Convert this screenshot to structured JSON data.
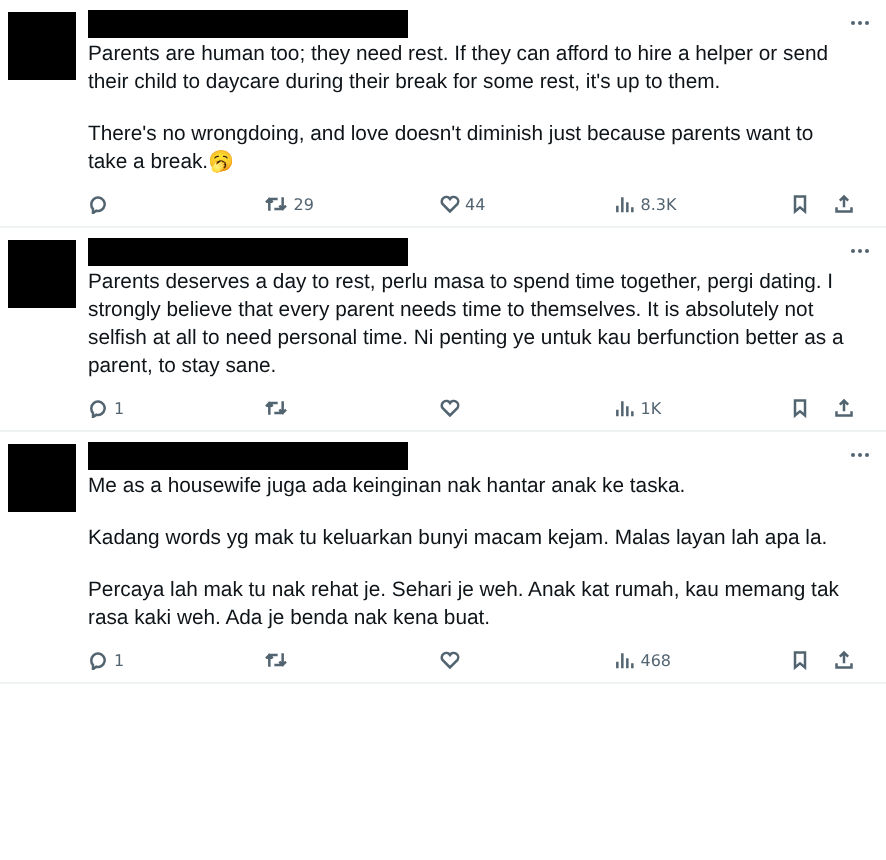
{
  "posts": [
    {
      "paragraphs": [
        "Parents are human too; they need rest. If they can afford to hire a helper or send their child to daycare during their break for some rest, it's up to them.",
        "There's no wrongdoing, and love doesn't diminish just because parents want to take a break.🥱"
      ],
      "stats": [
        {
          "kind": "reply"
        },
        {
          "kind": "repost",
          "count": "29"
        },
        {
          "kind": "like",
          "count": "44"
        },
        {
          "kind": "views",
          "count": "8.3K"
        }
      ]
    },
    {
      "paragraphs": [
        "Parents deserves a day to rest, perlu masa to spend time together, pergi dating. I strongly believe that every parent needs time to themselves. It is absolutely not selfish at all to need personal time. Ni penting ye untuk kau berfunction better as a parent, to stay sane."
      ],
      "stats": [
        {
          "kind": "reply",
          "count": "1"
        },
        {
          "kind": "repost"
        },
        {
          "kind": "like"
        },
        {
          "kind": "views",
          "count": "1K"
        }
      ]
    },
    {
      "paragraphs": [
        "Me as a housewife juga ada keinginan nak hantar anak ke taska.",
        "Kadang words yg mak tu keluarkan bunyi macam kejam. Malas layan lah apa la.",
        "Percaya lah mak tu nak rehat je. Sehari je weh. Anak kat rumah, kau memang tak rasa kaki weh. Ada je benda nak kena buat."
      ],
      "stats": [
        {
          "kind": "reply",
          "count": "1"
        },
        {
          "kind": "repost"
        },
        {
          "kind": "like"
        },
        {
          "kind": "views",
          "count": "468"
        }
      ]
    }
  ]
}
